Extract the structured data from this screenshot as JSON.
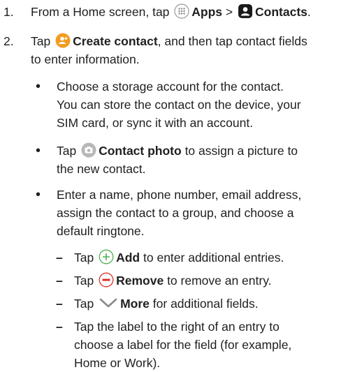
{
  "steps": [
    {
      "num": "1.",
      "pre": "From a Home screen, tap",
      "apps_label": "Apps",
      "sep": ">",
      "contacts_label": "Contacts",
      "end": "."
    },
    {
      "num": "2.",
      "pre": "Tap",
      "create_label": "Create contact",
      "line1_rest": ", and then tap contact fields",
      "line2": "to enter information."
    }
  ],
  "bullets": [
    {
      "line1": "Choose a storage account for the contact.",
      "line2": "You can store the contact on the device, your",
      "line3": "SIM card, or sync it with an account."
    },
    {
      "pre": "Tap",
      "bold": "Contact photo",
      "post": "to assign a picture to",
      "line2": "the new contact."
    },
    {
      "line1": "Enter a name, phone number, email address,",
      "line2": "assign the contact to a group, and choose a",
      "line3": "default ringtone."
    }
  ],
  "subbullets": [
    {
      "pre": "Tap",
      "bold": "Add",
      "post": "to enter additional entries."
    },
    {
      "pre": "Tap",
      "bold": "Remove",
      "post": "to remove an entry."
    },
    {
      "pre": "Tap",
      "bold": "More",
      "post": "for additional fields."
    },
    {
      "line1": "Tap the label to the right of an entry to",
      "line2": "choose a label for the field (for example,",
      "line3": "Home or Work)."
    }
  ],
  "colors": {
    "accent_orange": "#f39c1f",
    "add_green": "#4caf50",
    "remove_red": "#d9302a",
    "dark_icon": "#1a1a1a",
    "grey_icon": "#b7b7b7"
  }
}
